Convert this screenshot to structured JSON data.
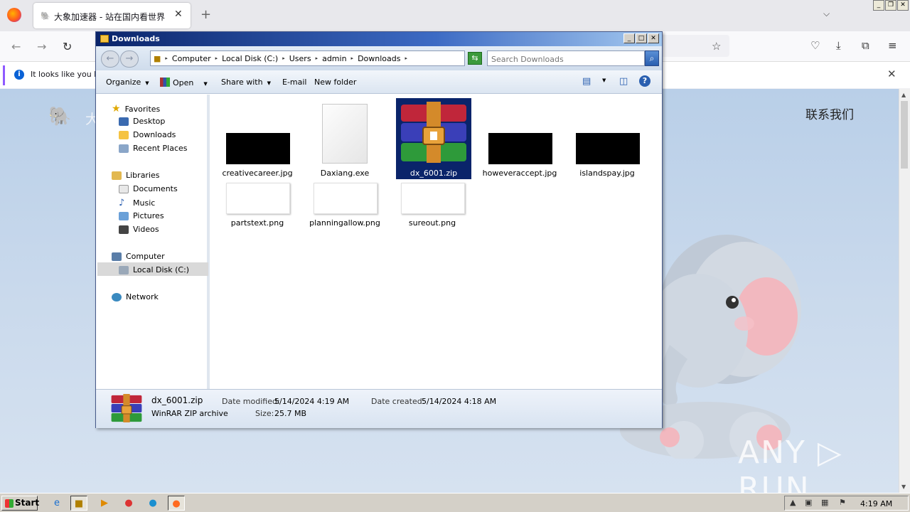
{
  "browser": {
    "tab_title": "大象加速器 - 站在国内看世界",
    "tab_icon": "elephant-favicon",
    "notification_text": "It looks like you ha",
    "new_tab_symbol": "+",
    "close_symbol": "✕"
  },
  "page": {
    "logo_text": "大",
    "contact_link": "联系我们",
    "watermark": "ANY ▷ RUN"
  },
  "explorer": {
    "title": "Downloads",
    "breadcrumb": [
      "Computer",
      "Local Disk (C:)",
      "Users",
      "admin",
      "Downloads"
    ],
    "search_placeholder": "Search Downloads",
    "toolbar": {
      "organize": "Organize",
      "open": "Open",
      "share_with": "Share with",
      "email": "E-mail",
      "new_folder": "New folder"
    },
    "nav": {
      "favorites": "Favorites",
      "desktop": "Desktop",
      "downloads": "Downloads",
      "recent_places": "Recent Places",
      "libraries": "Libraries",
      "documents": "Documents",
      "music": "Music",
      "pictures": "Pictures",
      "videos": "Videos",
      "computer": "Computer",
      "local_disk": "Local Disk (C:)",
      "network": "Network"
    },
    "files": [
      {
        "name": "creativecareer.jpg",
        "kind": "image-dark"
      },
      {
        "name": "Daxiang.exe",
        "kind": "exe"
      },
      {
        "name": "dx_6001.zip",
        "kind": "winrar",
        "selected": true
      },
      {
        "name": "howeveraccept.jpg",
        "kind": "image-dark"
      },
      {
        "name": "islandspay.jpg",
        "kind": "image-dark"
      },
      {
        "name": "partstext.png",
        "kind": "image-light"
      },
      {
        "name": "planningallow.png",
        "kind": "image-light"
      },
      {
        "name": "sureout.png",
        "kind": "image-light"
      }
    ],
    "status": {
      "filename": "dx_6001.zip",
      "filetype": "WinRAR ZIP archive",
      "date_modified_label": "Date modified:",
      "date_modified": "5/14/2024 4:19 AM",
      "date_created_label": "Date created:",
      "date_created": "5/14/2024 4:18 AM",
      "size_label": "Size:",
      "size": "25.7 MB"
    }
  },
  "taskbar": {
    "start": "Start",
    "clock": "4:19 AM"
  },
  "colors": {
    "selection": "#0a246a",
    "titlebar_start": "#0a246a",
    "page_bg": "#c9d9ec",
    "notif_accent": "#8f5aff"
  }
}
